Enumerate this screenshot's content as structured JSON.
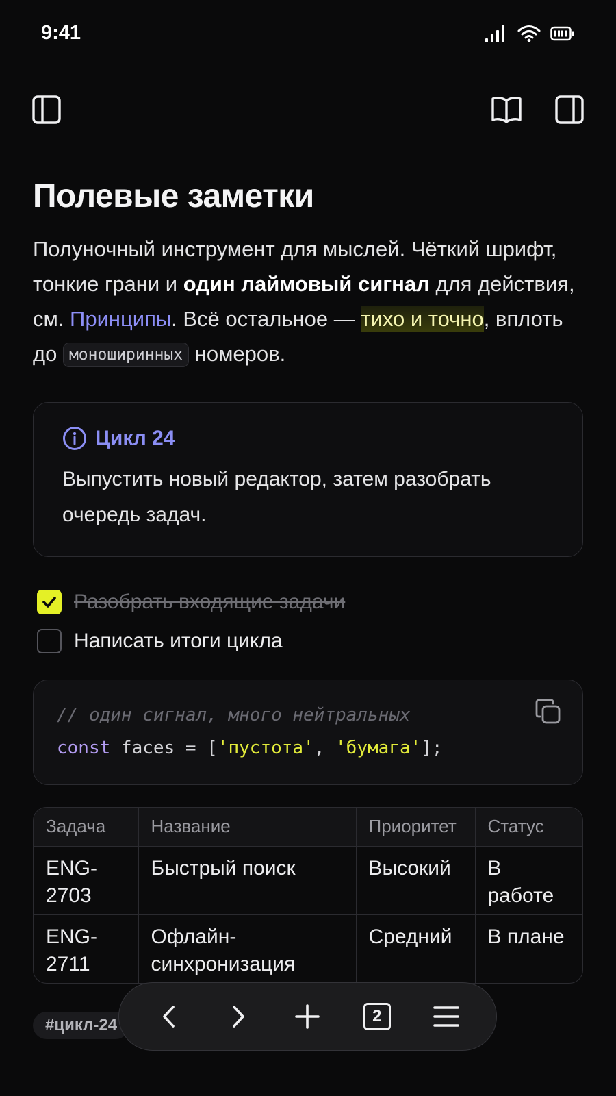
{
  "status_bar": {
    "time": "9:41"
  },
  "toolbar": {
    "left_icon": "sidebar-left-icon",
    "right_icons": [
      "book-icon",
      "sidebar-right-icon"
    ]
  },
  "document": {
    "title": "Полевые заметки",
    "lead": {
      "p1": "Полуночный инструмент для мыслей. Чёткий шрифт, тонкие грани и ",
      "bold": "один лаймовый сигнал",
      "p2": " для действия, см. ",
      "link": "Принципы",
      "p3": ". Всё остальное — ",
      "highlight": "тихо и точно",
      "p4": ", вплоть до ",
      "code": "моноширинных",
      "p5": " номеров."
    },
    "callout": {
      "icon": "info-icon",
      "title": "Цикл 24",
      "body": "Выпустить новый редактор, затем разобрать очередь задач."
    },
    "tasks": [
      {
        "label": "Разобрать входящие задачи",
        "done": true
      },
      {
        "label": "Написать итоги цикла",
        "done": false
      }
    ],
    "code_block": {
      "comment": "// один сигнал, много нейтральных",
      "kw": "const",
      "ident": " faces = [",
      "str1": "'пустота'",
      "sep": ", ",
      "str2": "'бумага'",
      "end": "];"
    },
    "table": {
      "headers": [
        "Задача",
        "Название",
        "Приоритет",
        "Статус"
      ],
      "rows": [
        [
          "ENG-2703",
          "Быстрый поиск",
          "Высокий",
          "В работе"
        ],
        [
          "ENG-2711",
          "Офлайн-синхронизация",
          "Средний",
          "В плане"
        ]
      ]
    },
    "tag": "#цикл-24"
  },
  "bottom_bar": {
    "icons": [
      "back-icon",
      "forward-icon",
      "new-tab-icon",
      "tabs-icon",
      "menu-icon"
    ],
    "tab_count": "2"
  },
  "colors": {
    "accent_lime": "#e4f026",
    "link_violet": "#8d8ff7",
    "background": "#0a0a0b"
  }
}
